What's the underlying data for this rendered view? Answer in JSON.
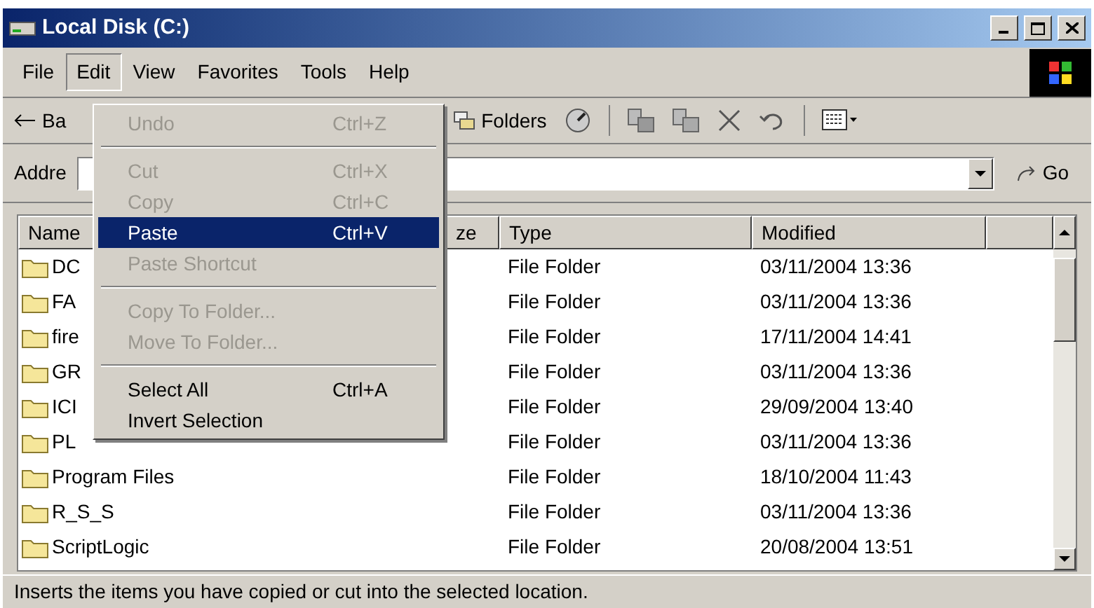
{
  "window": {
    "title": "Local Disk (C:)"
  },
  "menu_bar": [
    {
      "label": "File",
      "selected": false
    },
    {
      "label": "Edit",
      "selected": true
    },
    {
      "label": "View",
      "selected": false
    },
    {
      "label": "Favorites",
      "selected": false
    },
    {
      "label": "Tools",
      "selected": false
    },
    {
      "label": "Help",
      "selected": false
    }
  ],
  "toolbar": {
    "back": "Ba",
    "folders": "Folders"
  },
  "address_bar": {
    "label": "Addre",
    "go": "Go"
  },
  "edit_menu": [
    {
      "kind": "item",
      "label": "Undo",
      "shortcut": "Ctrl+Z",
      "disabled": true,
      "selected": false
    },
    {
      "kind": "separator"
    },
    {
      "kind": "item",
      "label": "Cut",
      "shortcut": "Ctrl+X",
      "disabled": true,
      "selected": false
    },
    {
      "kind": "item",
      "label": "Copy",
      "shortcut": "Ctrl+C",
      "disabled": true,
      "selected": false
    },
    {
      "kind": "item",
      "label": "Paste",
      "shortcut": "Ctrl+V",
      "disabled": false,
      "selected": true
    },
    {
      "kind": "item",
      "label": "Paste Shortcut",
      "disabled": true,
      "selected": false
    },
    {
      "kind": "separator"
    },
    {
      "kind": "item",
      "label": "Copy To Folder...",
      "disabled": true,
      "selected": false
    },
    {
      "kind": "item",
      "label": "Move To Folder...",
      "disabled": true,
      "selected": false
    },
    {
      "kind": "separator"
    },
    {
      "kind": "item",
      "label": "Select All",
      "shortcut": "Ctrl+A",
      "disabled": false,
      "selected": false
    },
    {
      "kind": "item",
      "label": "Invert Selection",
      "disabled": false,
      "selected": false
    }
  ],
  "table": {
    "columns": [
      "Name",
      "ze",
      "Type",
      "Modified"
    ],
    "rows": [
      {
        "name": "DC",
        "type": "File Folder",
        "modified": "03/11/2004 13:36"
      },
      {
        "name": "FA",
        "type": "File Folder",
        "modified": "03/11/2004 13:36"
      },
      {
        "name": "fire",
        "type": "File Folder",
        "modified": "17/11/2004 14:41"
      },
      {
        "name": "GR",
        "type": "File Folder",
        "modified": "03/11/2004 13:36"
      },
      {
        "name": "ICI",
        "type": "File Folder",
        "modified": "29/09/2004 13:40"
      },
      {
        "name": "PL",
        "type": "File Folder",
        "modified": "03/11/2004 13:36"
      },
      {
        "name": "Program Files",
        "type": "File Folder",
        "modified": "18/10/2004 11:43"
      },
      {
        "name": "R_S_S",
        "type": "File Folder",
        "modified": "03/11/2004 13:36"
      },
      {
        "name": "ScriptLogic",
        "type": "File Folder",
        "modified": "20/08/2004 13:51"
      }
    ]
  },
  "status_bar": "Inserts the items you have copied or cut into the selected location."
}
